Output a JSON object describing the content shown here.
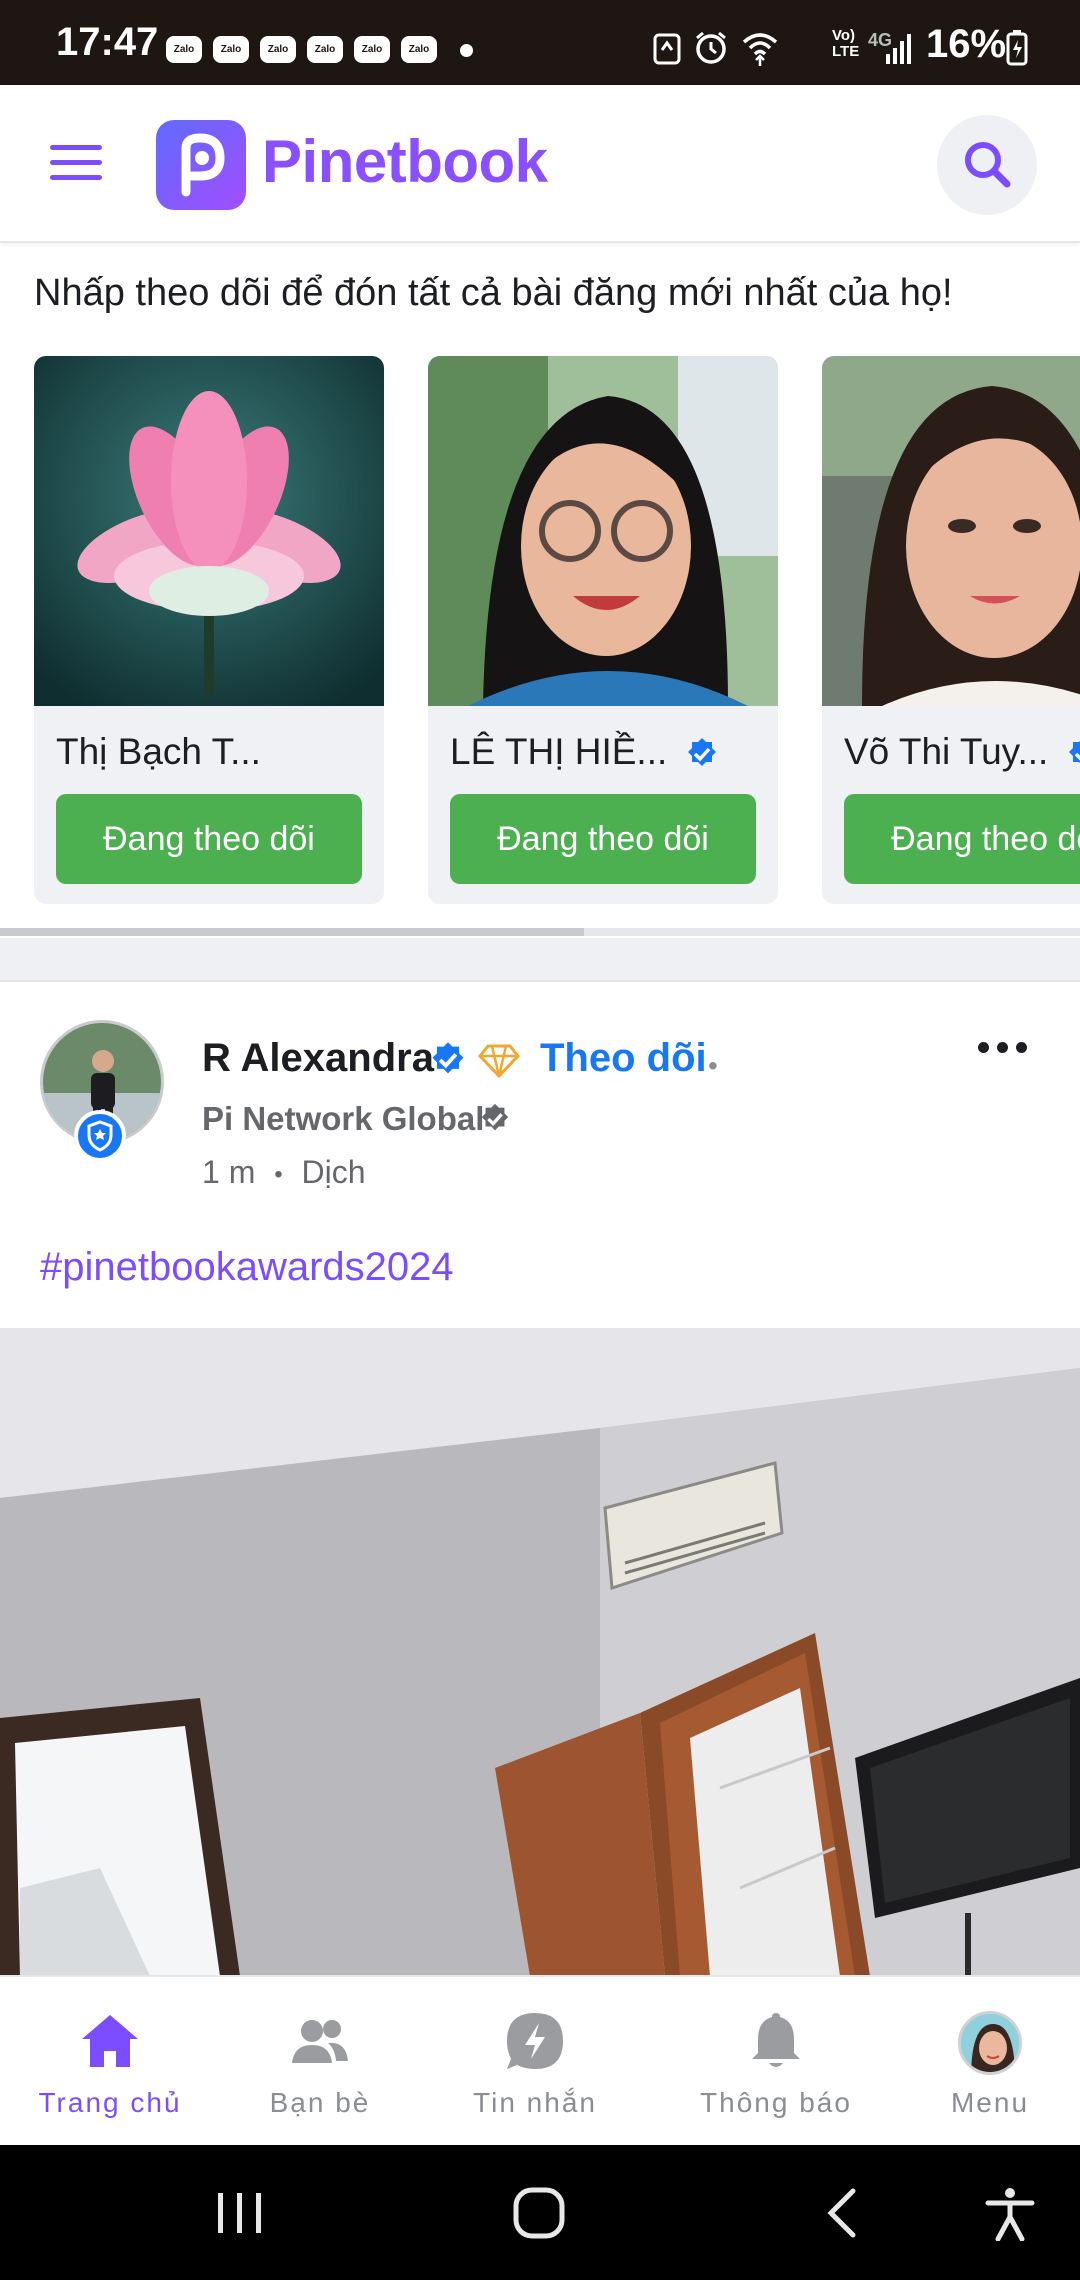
{
  "status_bar": {
    "time": "17:47",
    "notification_apps": [
      "Zalo",
      "Zalo",
      "Zalo",
      "Zalo",
      "Zalo",
      "Zalo"
    ],
    "network_label": "Vo)\nLTE",
    "network_type": "4G",
    "battery": "16%"
  },
  "header": {
    "app_name": "Pinetbook",
    "logo_letter": "P"
  },
  "suggestions": {
    "title": "Nhấp theo dõi để đón tất cả bài đăng mới nhất của họ!",
    "cards": [
      {
        "name": "Thị Bạch T...",
        "verified": false,
        "button": "Đang theo dõi"
      },
      {
        "name": "LÊ THỊ HIỀ...",
        "verified": true,
        "button": "Đang theo dõi"
      },
      {
        "name": "Võ Thi Tuy...",
        "verified": true,
        "button": "Đang theo dõi"
      }
    ]
  },
  "post": {
    "author": "R Alexandra",
    "follow_label": "Theo dõi",
    "separator": "•",
    "group": "Pi Network Global",
    "time": "1 m",
    "translate_label": "Dịch",
    "hashtag": "#pinetbookawards2024"
  },
  "bottom_nav": [
    {
      "label": "Trang chủ",
      "icon": "home-icon",
      "active": true
    },
    {
      "label": "Bạn bè",
      "icon": "friends-icon",
      "active": false
    },
    {
      "label": "Tin nhắn",
      "icon": "messages-icon",
      "active": false
    },
    {
      "label": "Thông báo",
      "icon": "bell-icon",
      "active": false
    },
    {
      "label": "Menu",
      "icon": "avatar",
      "active": false
    }
  ],
  "colors": {
    "brand": "#7c4dff",
    "follow_button": "#4caf50",
    "link_blue": "#1877f2"
  }
}
